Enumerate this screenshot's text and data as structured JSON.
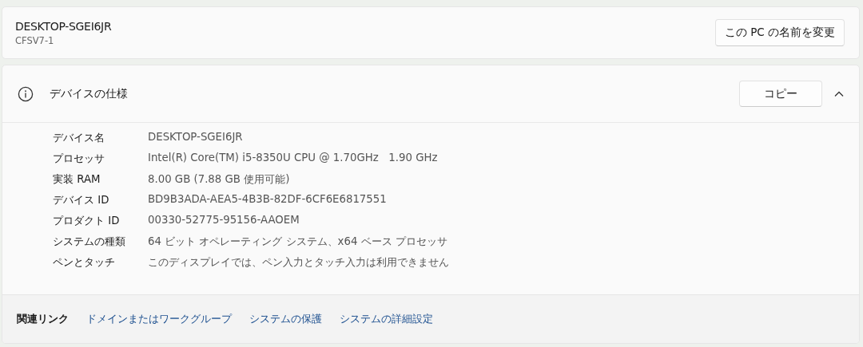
{
  "device_card": {
    "name": "DESKTOP-SGEI6JR",
    "model": "CFSV7-1",
    "rename_button": "この PC の名前を変更"
  },
  "specs_panel": {
    "title": "デバイスの仕様",
    "copy_button": "コピー",
    "expanded": true,
    "rows": [
      {
        "label": "デバイス名",
        "value": "DESKTOP-SGEI6JR"
      },
      {
        "label": "プロセッサ",
        "value": "Intel(R) Core(TM) i5-8350U CPU @ 1.70GHz   1.90 GHz"
      },
      {
        "label": "実装 RAM",
        "value": "8.00 GB (7.88 GB 使用可能)"
      },
      {
        "label": "デバイス ID",
        "value": "BD9B3ADA-AEA5-4B3B-82DF-6CF6E6817551"
      },
      {
        "label": "プロダクト ID",
        "value": "00330-52775-95156-AAOEM"
      },
      {
        "label": "システムの種類",
        "value": "64 ビット オペレーティング システム、x64 ベース プロセッサ"
      },
      {
        "label": "ペンとタッチ",
        "value": "このディスプレイでは、ペン入力とタッチ入力は利用できません"
      }
    ],
    "related_links": {
      "label": "関連リンク",
      "links": [
        "ドメインまたはワークグループ",
        "システムの保護",
        "システムの詳細設定"
      ]
    }
  }
}
